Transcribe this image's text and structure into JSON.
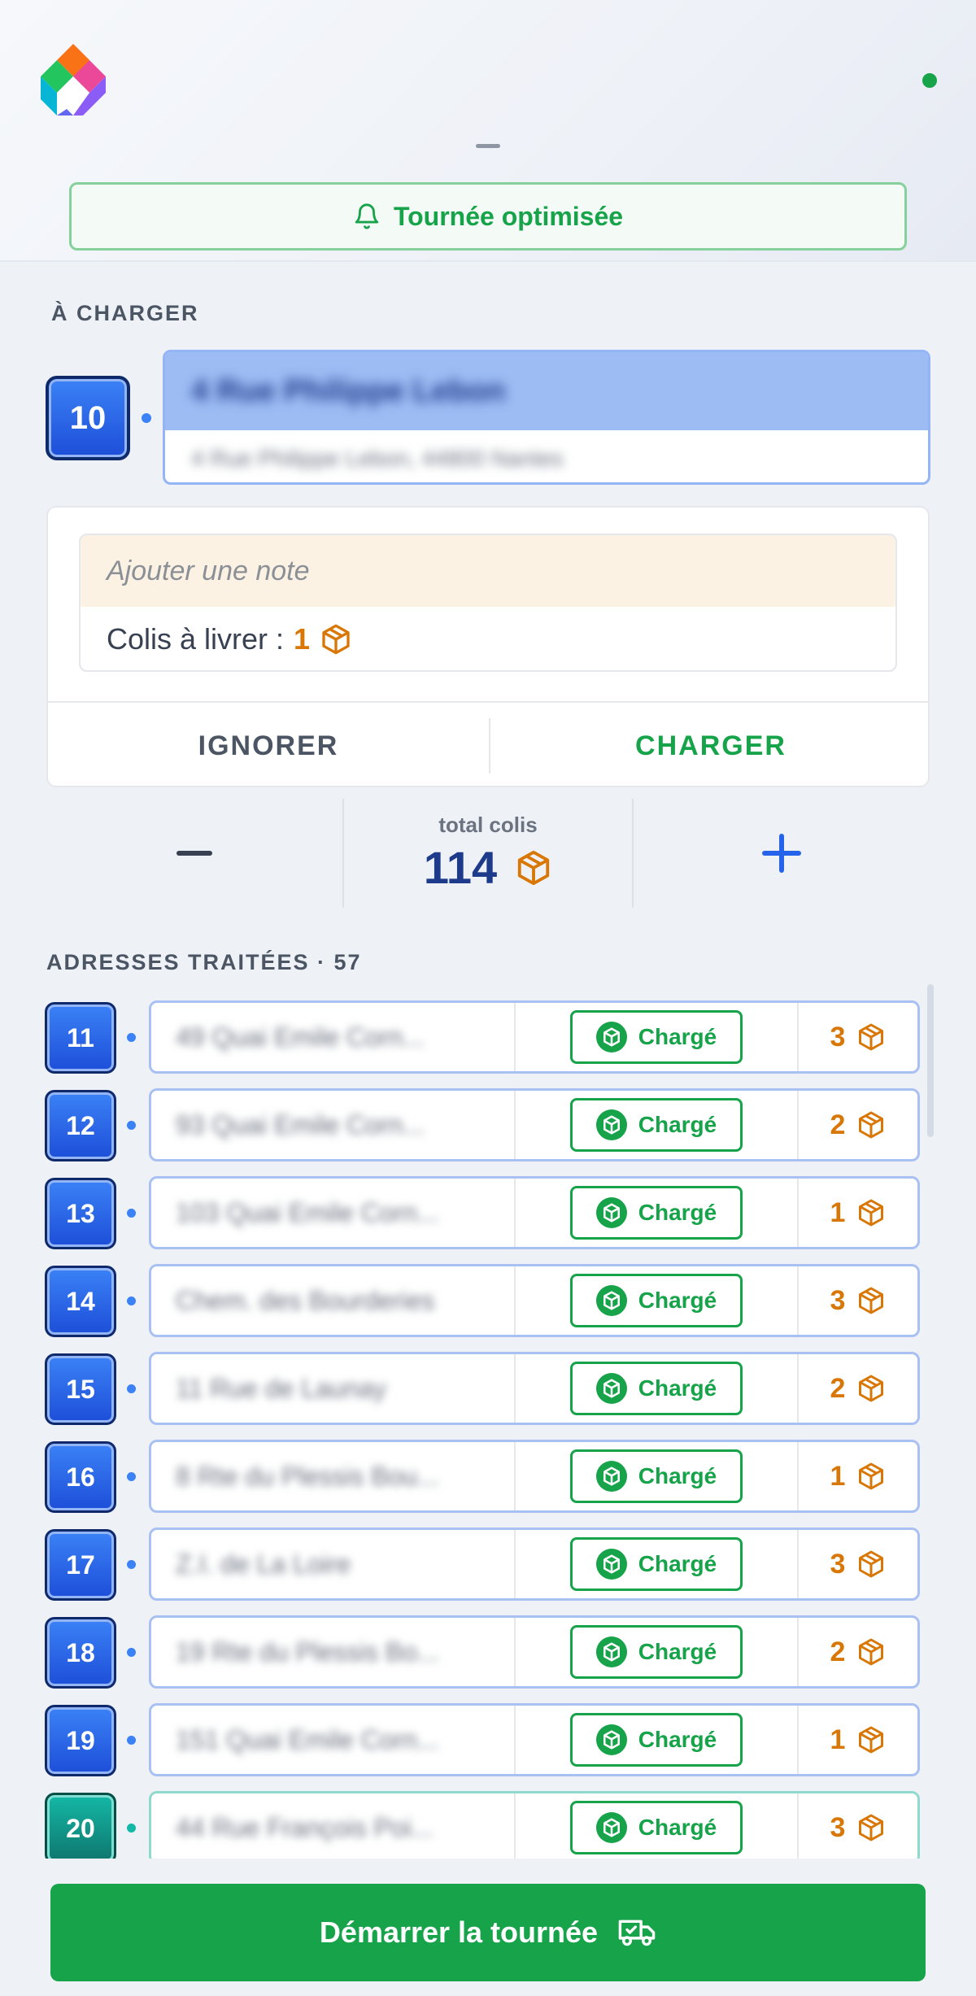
{
  "header": {
    "banner_text": "Tournée optimisée"
  },
  "current": {
    "section_title": "À CHARGER",
    "stop_number": "10",
    "address_main": "4 Rue Philippe Lebon",
    "address_full": "4 Rue Philippe Lebon, 44800 Nantes",
    "note_placeholder": "Ajouter une note",
    "colis_label": "Colis à livrer :",
    "colis_count": "1",
    "ignore_label": "IGNORER",
    "charge_label": "CHARGER"
  },
  "stepper": {
    "total_label": "total colis",
    "total_value": "114"
  },
  "processed": {
    "section_title": "ADRESSES TRAITÉES · 57",
    "rows": [
      {
        "num": "11",
        "address": "49 Quai Emile Corn...",
        "status": "Chargé",
        "count": "3",
        "variant": "blue"
      },
      {
        "num": "12",
        "address": "93 Quai Emile Corn...",
        "status": "Chargé",
        "count": "2",
        "variant": "blue"
      },
      {
        "num": "13",
        "address": "103 Quai Emile Corn...",
        "status": "Chargé",
        "count": "1",
        "variant": "blue"
      },
      {
        "num": "14",
        "address": "Chem. des Bourderies",
        "status": "Chargé",
        "count": "3",
        "variant": "blue"
      },
      {
        "num": "15",
        "address": "11 Rue de Launay",
        "status": "Chargé",
        "count": "2",
        "variant": "blue"
      },
      {
        "num": "16",
        "address": "8 Rte du Plessis Bou...",
        "status": "Chargé",
        "count": "1",
        "variant": "blue"
      },
      {
        "num": "17",
        "address": "Z.I. de La Loire",
        "status": "Chargé",
        "count": "3",
        "variant": "blue"
      },
      {
        "num": "18",
        "address": "19 Rte du Plessis Bo...",
        "status": "Chargé",
        "count": "2",
        "variant": "blue"
      },
      {
        "num": "19",
        "address": "151 Quai Emile Corn...",
        "status": "Chargé",
        "count": "1",
        "variant": "blue"
      },
      {
        "num": "20",
        "address": "44 Rue François Poi...",
        "status": "Chargé",
        "count": "3",
        "variant": "teal"
      }
    ]
  },
  "footer": {
    "start_label": "Démarrer la tournée"
  },
  "colors": {
    "accent_green": "#16a34a",
    "accent_blue": "#2563eb",
    "package_orange": "#d97706",
    "badge_teal": "#0f766e"
  },
  "icons": {
    "banner": "bell-icon",
    "package": "package-icon",
    "status": "loaded-status-icon",
    "start": "truck-icon"
  }
}
